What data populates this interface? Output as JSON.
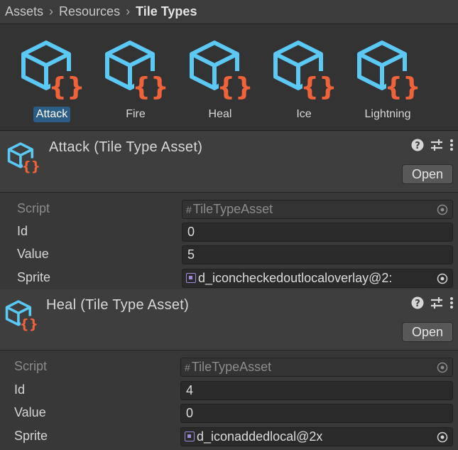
{
  "breadcrumb": {
    "items": [
      "Assets",
      "Resources"
    ],
    "current": "Tile Types"
  },
  "asset_grid": {
    "items": [
      {
        "label": "Attack",
        "selected": true
      },
      {
        "label": "Fire",
        "selected": false
      },
      {
        "label": "Heal",
        "selected": false
      },
      {
        "label": "Ice",
        "selected": false
      },
      {
        "label": "Lightning",
        "selected": false
      }
    ]
  },
  "inspectors": [
    {
      "title": "Attack (Tile Type Asset)",
      "open_label": "Open",
      "script_label": "Script",
      "script_value": "TileTypeAsset",
      "id_label": "Id",
      "id_value": "0",
      "value_label": "Value",
      "value_value": "5",
      "sprite_label": "Sprite",
      "sprite_value": "d_iconcheckedoutlocaloverlay@2:"
    },
    {
      "title": "Heal (Tile Type Asset)",
      "open_label": "Open",
      "script_label": "Script",
      "script_value": "TileTypeAsset",
      "id_label": "Id",
      "id_value": "4",
      "value_label": "Value",
      "value_value": "0",
      "sprite_label": "Sprite",
      "sprite_value": "d_iconaddedlocal@2x"
    }
  ],
  "icons": {
    "help": "help-icon",
    "presets": "presets-icon",
    "more": "more-menu-icon",
    "asset": "scriptable-object-icon",
    "picker": "object-picker-icon"
  },
  "colors": {
    "accent_blue": "#5cc8f4",
    "accent_orange": "#f0623a",
    "selection": "#2c5d87"
  }
}
